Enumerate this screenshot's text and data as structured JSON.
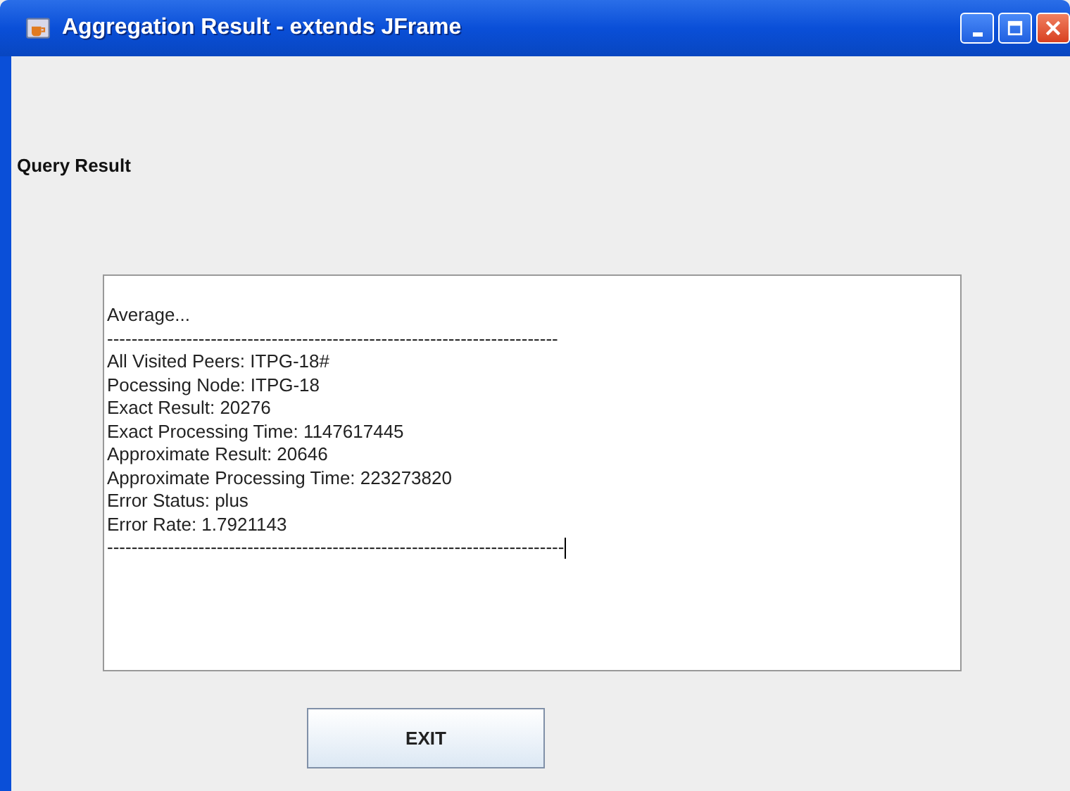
{
  "window": {
    "title": "Aggregation Result - extends JFrame"
  },
  "heading": "Query Result",
  "result_area": {
    "lines": [
      "Average...",
      "--------------------------------------------------------------------------",
      "All Visited Peers: ITPG-18#",
      "Pocessing Node: ITPG-18",
      "Exact Result: 20276",
      "Exact Processing Time: 1147617445",
      "Approximate Result: 20646",
      "Approximate Processing Time: 223273820",
      "Error Status: plus",
      "Error Rate: 1.7921143",
      "---------------------------------------------------------------------------"
    ]
  },
  "buttons": [
    "EXIT"
  ]
}
